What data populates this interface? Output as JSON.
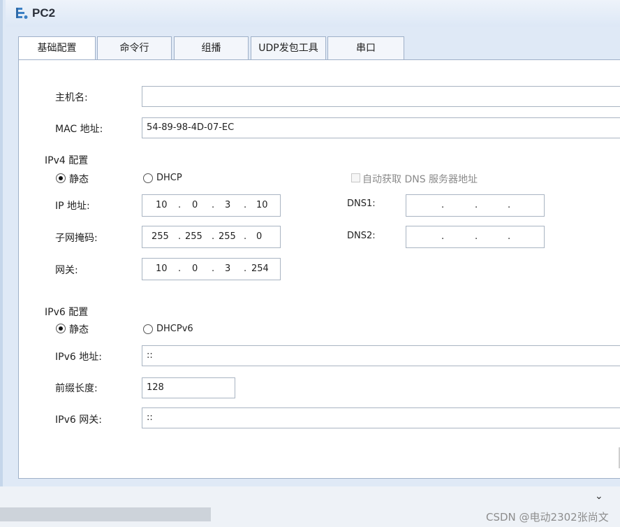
{
  "window": {
    "title": "PC2",
    "icon": "network-pc-icon"
  },
  "tabs": [
    {
      "label": "基础配置",
      "active": true
    },
    {
      "label": "命令行"
    },
    {
      "label": "组播"
    },
    {
      "label": "UDP发包工具"
    },
    {
      "label": "串口"
    }
  ],
  "basic": {
    "hostname_label": "主机名:",
    "hostname_value": "",
    "mac_label": "MAC 地址:",
    "mac_value": "54-89-98-4D-07-EC"
  },
  "ipv4": {
    "section_title": "IPv4 配置",
    "static_label": "静态",
    "dhcp_label": "DHCP",
    "mode": "static",
    "auto_dns_label": "自动获取 DNS 服务器地址",
    "ip_label": "IP 地址:",
    "ip": [
      "10",
      "0",
      "3",
      "10"
    ],
    "mask_label": "子网掩码:",
    "mask": [
      "255",
      "255",
      "255",
      "0"
    ],
    "gateway_label": "网关:",
    "gateway": [
      "10",
      "0",
      "3",
      "254"
    ],
    "dns1_label": "DNS1:",
    "dns2_label": "DNS2:",
    "dot": "."
  },
  "ipv6": {
    "section_title": "IPv6 配置",
    "static_label": "静态",
    "dhcp_label": "DHCPv6",
    "mode": "static",
    "address_label": "IPv6 地址:",
    "address_value": "::",
    "prefix_label": "前缀长度:",
    "prefix_value": "128",
    "gateway_label": "IPv6 网关:",
    "gateway_value": "::"
  },
  "watermark": "CSDN @电动2302张尚文"
}
